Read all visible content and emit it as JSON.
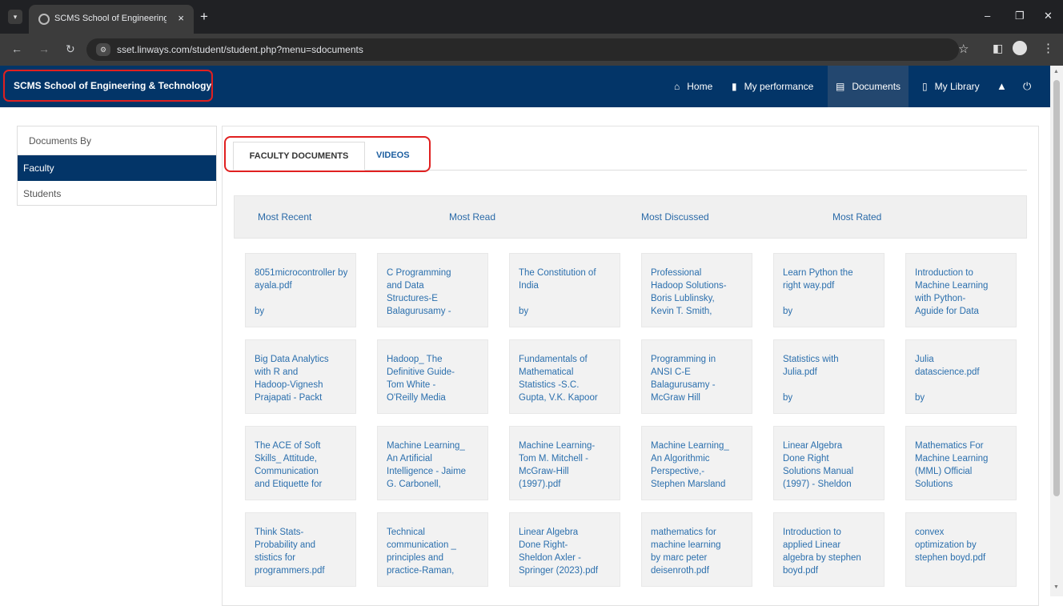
{
  "browser": {
    "tab_title": "SCMS School of Engineering &",
    "tab_close": "×",
    "new_tab": "+",
    "url": "sset.linways.com/student/student.php?menu=sdocuments",
    "icons": [
      "chevron-down-icon",
      "globe-icon",
      "back-icon",
      "forward-icon",
      "reload-icon",
      "site-settings-icon",
      "star-icon",
      "sidepanel-icon",
      "profile-icon",
      "kebab-icon",
      "minimize-icon",
      "maximize-icon",
      "close-icon"
    ]
  },
  "navbar": {
    "brand": "SCMS School of Engineering & Technology",
    "items": [
      {
        "label": "Home",
        "icon": "home-icon"
      },
      {
        "label": "My performance",
        "icon": "bar-chart-icon"
      },
      {
        "label": "Documents",
        "icon": "document-icon"
      },
      {
        "label": "My Library",
        "icon": "book-icon"
      }
    ],
    "active_item": "Documents",
    "bell_icon": "bell-icon",
    "power_icon": "power-icon",
    "colors": {
      "bar": "#033568",
      "active": "#23476f"
    }
  },
  "sidebar": {
    "heading": "Documents By",
    "items": [
      {
        "label": "Faculty",
        "active": true
      },
      {
        "label": "Students",
        "active": false
      }
    ]
  },
  "tabs": [
    {
      "label": "FACULTY DOCUMENTS",
      "active": true
    },
    {
      "label": "VIDEOS",
      "active": false
    }
  ],
  "filters": [
    "Most Recent",
    "Most Read",
    "Most Discussed",
    "Most Rated"
  ],
  "documents": [
    [
      "8051microcontroller by ayala.pdf",
      "",
      "",
      "by"
    ],
    [
      "C Programming",
      "and Data",
      "Structures-E",
      "Balagurusamy -"
    ],
    [
      "The Constitution of",
      "India",
      "",
      "by"
    ],
    [
      "Professional",
      "Hadoop Solutions-",
      "Boris Lublinsky,",
      "Kevin T. Smith,"
    ],
    [
      "Learn Python the",
      "right way.pdf",
      "",
      "by"
    ],
    [
      "Introduction to",
      "Machine Learning",
      "with Python-",
      "Aguide for Data"
    ],
    [
      "Big Data Analytics",
      "with R and",
      "Hadoop-Vignesh",
      "Prajapati - Packt"
    ],
    [
      "Hadoop_ The",
      "Definitive Guide-",
      "Tom White -",
      "O'Reilly Media"
    ],
    [
      "Fundamentals of",
      "Mathematical",
      "Statistics -S.C.",
      "Gupta, V.K. Kapoor"
    ],
    [
      "Programming in",
      "ANSI C-E",
      "Balagurusamy -",
      "McGraw Hill"
    ],
    [
      "Statistics with",
      "Julia.pdf",
      "",
      "by"
    ],
    [
      "Julia",
      "datascience.pdf",
      "",
      "by"
    ],
    [
      "The ACE of Soft",
      "Skills_ Attitude,",
      "Communication",
      "and Etiquette for"
    ],
    [
      "Machine Learning_",
      "An Artificial",
      "Intelligence - Jaime",
      "G. Carbonell,"
    ],
    [
      "Machine Learning-",
      "Tom M. Mitchell -",
      "McGraw-Hill",
      "(1997).pdf"
    ],
    [
      "Machine Learning_",
      "An Algorithmic",
      "Perspective,-",
      "Stephen Marsland"
    ],
    [
      "Linear Algebra",
      "Done Right",
      "Solutions Manual",
      "(1997) - Sheldon"
    ],
    [
      "Mathematics For",
      "Machine Learning",
      "(MML) Official",
      "Solutions"
    ],
    [
      "Think Stats-",
      "Probability and",
      "stistics for",
      "programmers.pdf"
    ],
    [
      "Technical",
      "communication _",
      "principles and",
      "practice-Raman,"
    ],
    [
      "Linear Algebra",
      "Done Right-",
      "Sheldon Axler -",
      "Springer (2023).pdf"
    ],
    [
      "mathematics for",
      "machine learning",
      "by marc peter",
      "deisenroth.pdf"
    ],
    [
      "Introduction to",
      "applied Linear",
      "algebra by stephen",
      "boyd.pdf"
    ],
    [
      "convex",
      "optimization by",
      "stephen boyd.pdf",
      ""
    ]
  ]
}
